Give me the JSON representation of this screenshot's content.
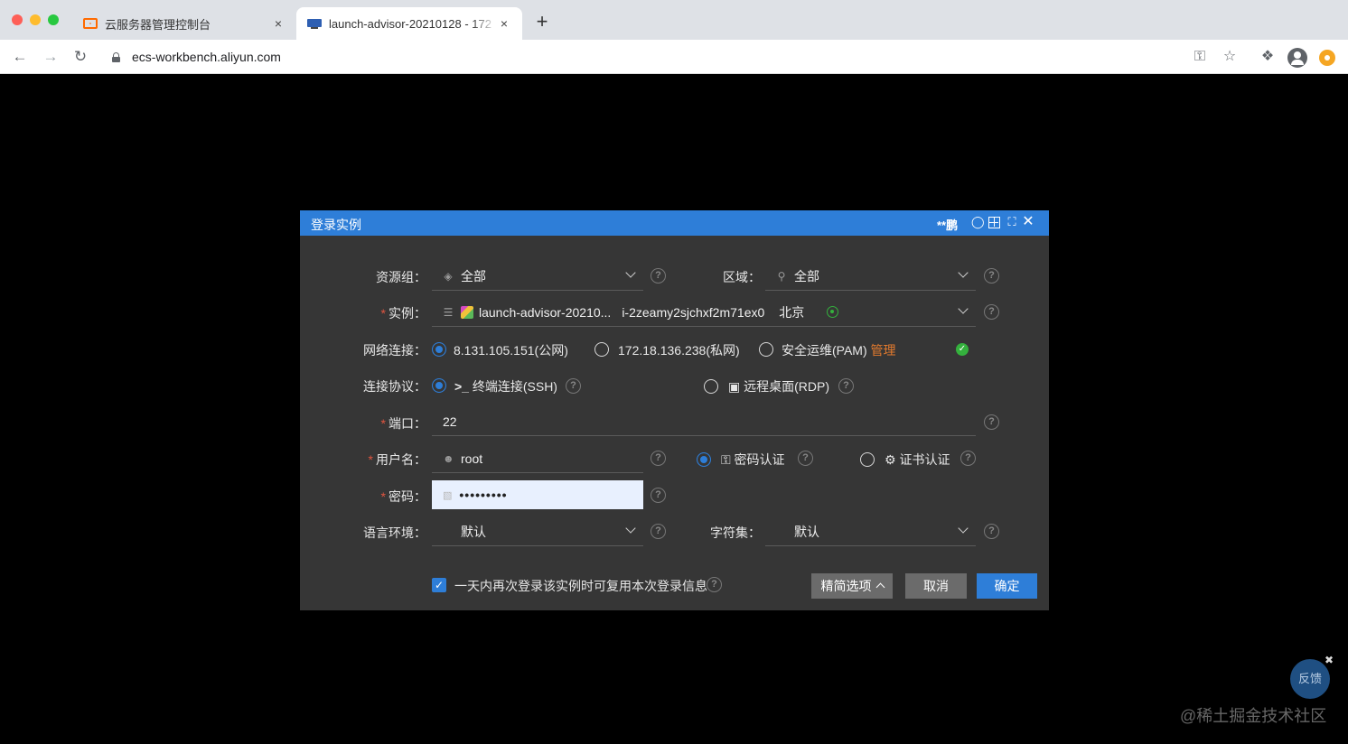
{
  "browser": {
    "tabs": [
      {
        "title": "云服务器管理控制台",
        "close": "×"
      },
      {
        "title": "launch-advisor-20210128 - 172",
        "close": "×"
      }
    ],
    "new_tab": "+",
    "url": "ecs-workbench.aliyun.com"
  },
  "dialog": {
    "title": "登录实例",
    "user": "**鹏",
    "resource_group": {
      "label": "资源组：",
      "value": "全部"
    },
    "region": {
      "label": "区域：",
      "value": "全部"
    },
    "instance": {
      "label": "实例：",
      "name": "launch-advisor-20210...",
      "id": "i-2zeamy2sjchxf2m71ex0",
      "region": "北京"
    },
    "network": {
      "label": "网络连接：",
      "options": [
        "8.131.105.151(公网)",
        "172.18.136.238(私网)",
        "安全运维(PAM)"
      ],
      "manage_link": "管理",
      "selected": 0
    },
    "protocol": {
      "label": "连接协议：",
      "options": [
        "终端连接(SSH)",
        "远程桌面(RDP)"
      ],
      "selected": 0
    },
    "port": {
      "label": "端口：",
      "value": "22"
    },
    "username": {
      "label": "用户名：",
      "value": "root",
      "auth_options": [
        "密码认证",
        "证书认证"
      ],
      "selected_auth": 0
    },
    "password": {
      "label": "密码：",
      "masked": "•••••••••"
    },
    "locale": {
      "label": "语言环境：",
      "value": "默认"
    },
    "charset": {
      "label": "字符集：",
      "value": "默认"
    },
    "remember": {
      "label": "一天内再次登录该实例时可复用本次登录信息",
      "checked": true
    },
    "buttons": {
      "advanced": "精简选项",
      "cancel": "取消",
      "confirm": "确定"
    },
    "colors": {
      "header": "#2e7ed8",
      "body": "#363636",
      "primary": "#2e7ed8",
      "link": "#e27a2e",
      "success": "#34b13d"
    }
  },
  "feedback": {
    "label": "反馈"
  },
  "watermark": "@稀土掘金技术社区"
}
